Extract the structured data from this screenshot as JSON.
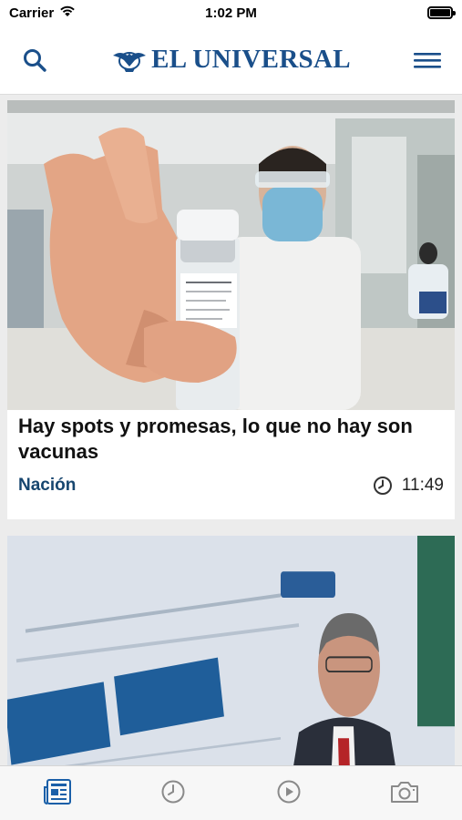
{
  "status_bar": {
    "carrier": "Carrier",
    "time": "1:02 PM",
    "battery_level": 1.0
  },
  "header": {
    "logo_text": "EL UNIVERSAL",
    "search_icon": "search-icon",
    "menu_icon": "hamburger-menu-icon",
    "brand_color": "#1a4f8a"
  },
  "feed": {
    "articles": [
      {
        "title": "Hay spots y promesas, lo que no hay son vacunas",
        "section": "Nación",
        "time": "11:49",
        "image": "photo-hand-holding-vaccine-vial",
        "clock_icon": "clock-icon"
      },
      {
        "image": "photo-man-in-suit-at-press-conference"
      }
    ]
  },
  "tab_bar": {
    "tabs": [
      {
        "icon": "newspaper-icon",
        "active": true
      },
      {
        "icon": "clock-icon",
        "active": false
      },
      {
        "icon": "play-icon",
        "active": false
      },
      {
        "icon": "camera-icon",
        "active": false
      }
    ],
    "active_color": "#1a5fa8",
    "inactive_color": "#8a8a8a"
  }
}
